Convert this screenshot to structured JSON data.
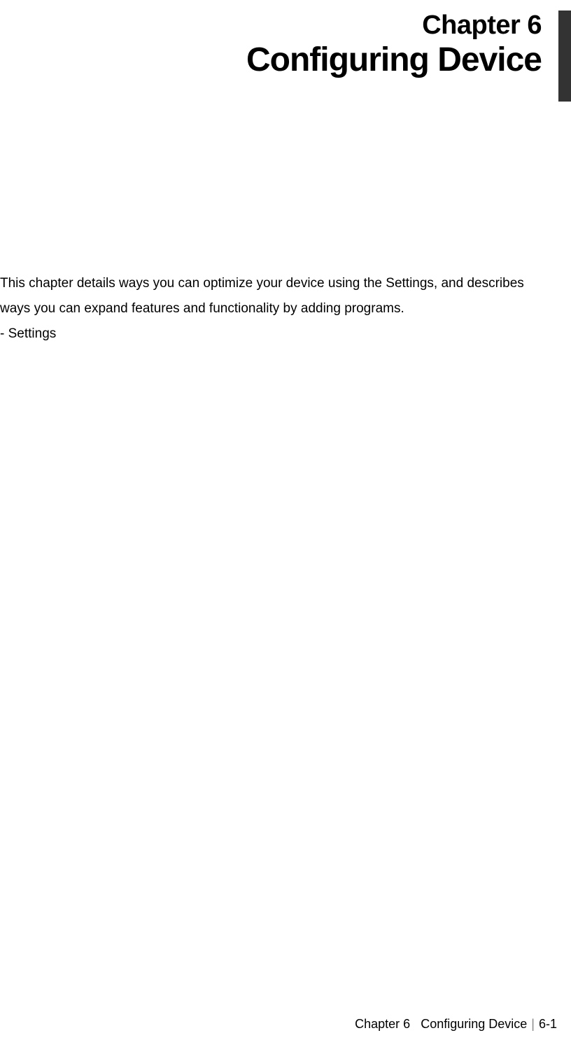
{
  "header": {
    "chapter_number": "Chapter 6",
    "chapter_title": "Configuring Device"
  },
  "body": {
    "intro_text": "This chapter details ways you can optimize your device using the Settings, and describes ways you can expand features and functionality by adding programs.",
    "bullet_item": "- Settings"
  },
  "footer": {
    "chapter_ref": "Chapter 6",
    "title_ref": "Configuring Device",
    "page_number": "6-1"
  }
}
